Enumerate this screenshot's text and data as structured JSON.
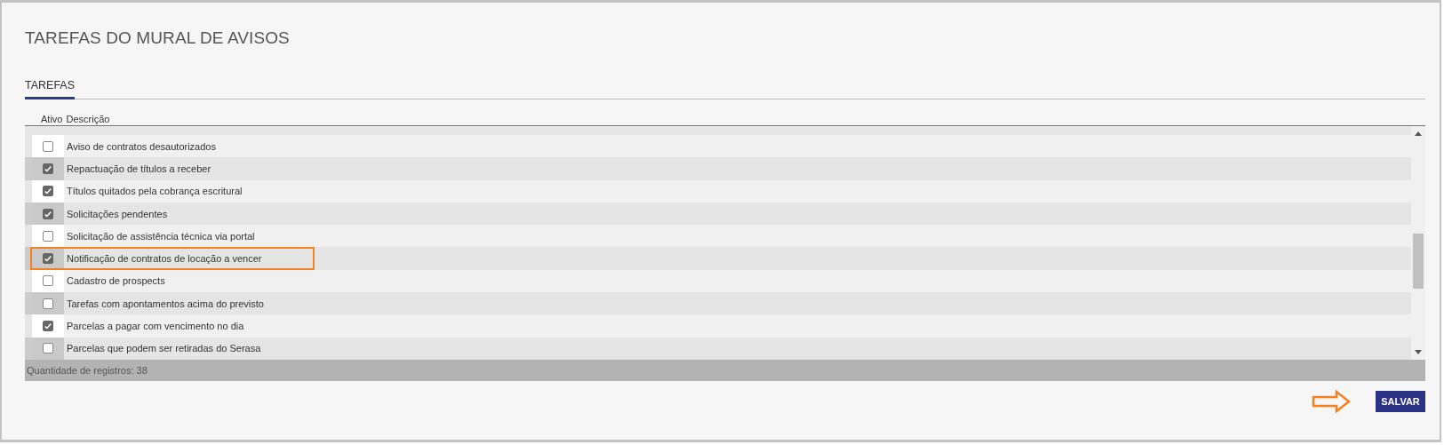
{
  "title": "TAREFAS DO MURAL DE AVISOS",
  "tabs": [
    {
      "label": "TAREFAS",
      "selected": true
    }
  ],
  "table": {
    "columns": [
      "Ativo",
      "Descrição"
    ],
    "rows": [
      {
        "description": "Aviso de contratos desautorizados",
        "checked": false,
        "annotated": false
      },
      {
        "description": "Repactuação de títulos a receber",
        "checked": true,
        "annotated": false
      },
      {
        "description": "Títulos quitados pela cobrança escritural",
        "checked": true,
        "annotated": false
      },
      {
        "description": "Solicitações pendentes",
        "checked": true,
        "annotated": false
      },
      {
        "description": "Solicitação de assistência técnica via portal",
        "checked": false,
        "annotated": false
      },
      {
        "description": "Notificação de contratos de locação a vencer",
        "checked": true,
        "annotated": true
      },
      {
        "description": "Cadastro de prospects",
        "checked": false,
        "annotated": false
      },
      {
        "description": "Tarefas com apontamentos acima do previsto",
        "checked": false,
        "annotated": false
      },
      {
        "description": "Parcelas a pagar com vencimento no dia",
        "checked": true,
        "annotated": false
      },
      {
        "description": "Parcelas que podem ser retiradas do Serasa",
        "checked": false,
        "annotated": false
      }
    ],
    "footer": "Quantidade de registros: 38"
  },
  "save_button": "SALVAR"
}
